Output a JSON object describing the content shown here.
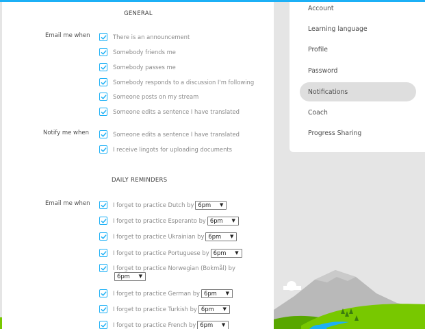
{
  "general": {
    "title": "GENERAL",
    "email_label": "Email me when",
    "email_options": [
      "There is an announcement",
      "Somebody friends me",
      "Somebody passes me",
      "Somebody responds to a discussion I'm following",
      "Someone posts on my stream",
      "Someone edits a sentence I have translated"
    ],
    "notify_label": "Notify me when",
    "notify_options": [
      "Someone edits a sentence I have translated",
      "I receive lingots for uploading documents"
    ]
  },
  "daily": {
    "title": "DAILY REMINDERS",
    "email_label": "Email me when",
    "reminders": [
      {
        "text": "I forget to practice Dutch by",
        "time": "6pm"
      },
      {
        "text": "I forget to practice Esperanto by",
        "time": "6pm"
      },
      {
        "text": "I forget to practice Ukrainian by",
        "time": "6pm"
      },
      {
        "text": "I forget to practice Portuguese by",
        "time": "6pm"
      },
      {
        "text": "I forget to practice Norwegian (Bokmål) by",
        "time": "6pm"
      },
      {
        "text": "I forget to practice German by",
        "time": "6pm"
      },
      {
        "text": "I forget to practice Turkish by",
        "time": "6pm"
      },
      {
        "text": "I forget to practice French by",
        "time": "6pm"
      }
    ]
  },
  "sidebar": {
    "items": [
      "Account",
      "Learning language",
      "Profile",
      "Password",
      "Notifications",
      "Coach",
      "Progress Sharing"
    ],
    "active": "Notifications"
  },
  "colors": {
    "accent": "#1cb0f6",
    "active_bg": "#dedede",
    "grass": "#78c800"
  },
  "icons": {
    "checkbox": "checkmark-icon",
    "dropdown": "triangle-down-icon"
  }
}
